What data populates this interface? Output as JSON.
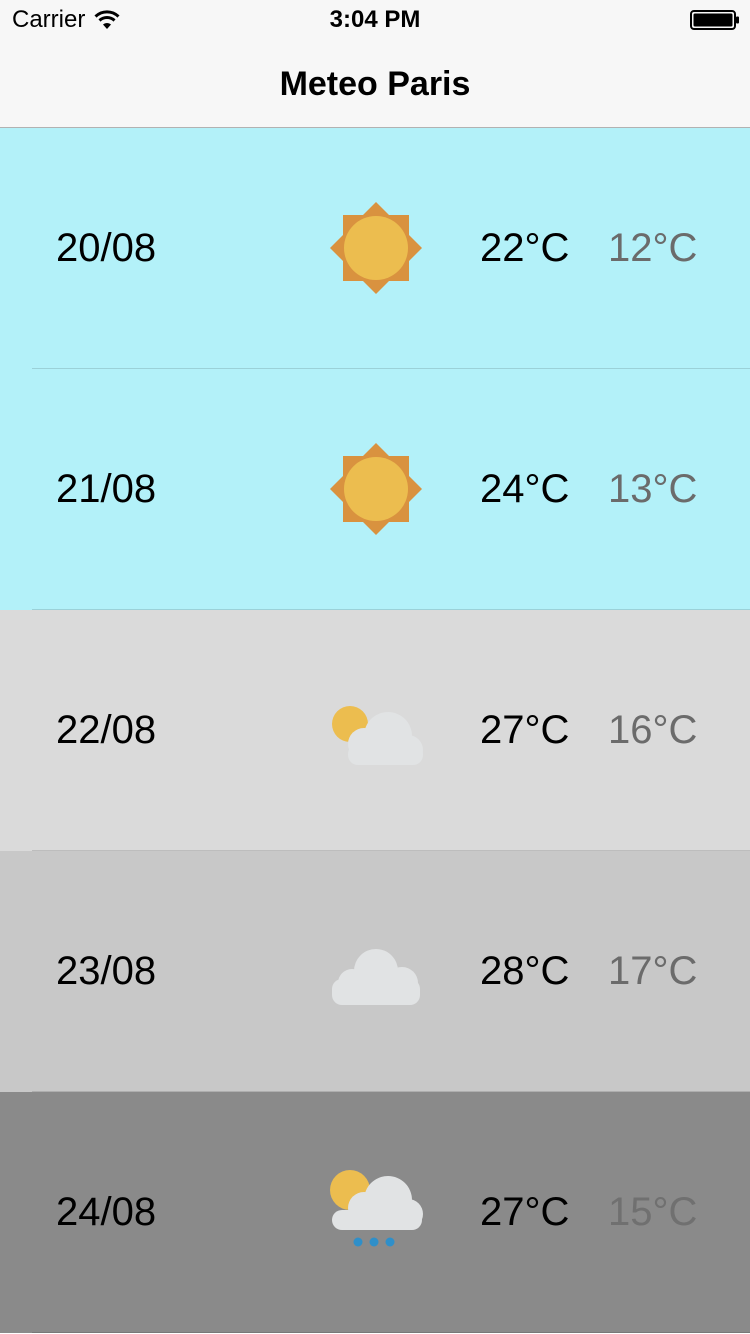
{
  "status_bar": {
    "carrier": "Carrier",
    "time": "3:04 PM",
    "wifi_icon": "wifi-icon",
    "battery_icon": "battery-icon"
  },
  "nav": {
    "title": "Meteo Paris"
  },
  "colors": {
    "sunny_bg": "#b3f1f9",
    "partly_cloudy_bg": "#dadada",
    "cloudy_bg": "#c8c8c8",
    "rainy_bg": "#8a8a8a",
    "sun": "#ecbd4f",
    "sun_rays": "#d9923f",
    "cloud": "#e1e3e4",
    "rain": "#2f8fc9",
    "min_temp_light": "#6b6b6b",
    "min_temp_dark": "#707070"
  },
  "forecast": [
    {
      "date": "20/08",
      "icon": "sun-icon",
      "max": "22°C",
      "min": "12°C"
    },
    {
      "date": "21/08",
      "icon": "sun-icon",
      "max": "24°C",
      "min": "13°C"
    },
    {
      "date": "22/08",
      "icon": "partly-cloudy-icon",
      "max": "27°C",
      "min": "16°C"
    },
    {
      "date": "23/08",
      "icon": "cloud-icon",
      "max": "28°C",
      "min": "17°C"
    },
    {
      "date": "24/08",
      "icon": "rain-icon",
      "max": "27°C",
      "min": "15°C"
    }
  ]
}
